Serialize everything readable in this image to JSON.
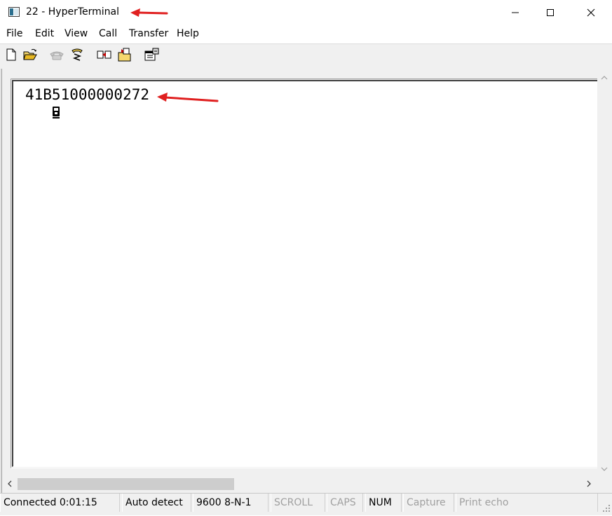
{
  "window": {
    "title": "22 - HyperTerminal",
    "icon": "hyperterminal-app-icon",
    "controls": [
      "minimize-icon",
      "maximize-icon",
      "close-icon"
    ]
  },
  "menu": {
    "items": [
      "File",
      "Edit",
      "View",
      "Call",
      "Transfer",
      "Help"
    ]
  },
  "toolbar": {
    "buttons": [
      {
        "name": "new-connection",
        "icon": "new-document-icon",
        "enabled": true
      },
      {
        "name": "open",
        "icon": "open-folder-icon",
        "enabled": true
      },
      {
        "name": "connect",
        "icon": "phone-icon",
        "enabled": false
      },
      {
        "name": "disconnect",
        "icon": "disconnect-phone-icon",
        "enabled": true
      },
      {
        "name": "send-file",
        "icon": "send-file-icon",
        "enabled": true
      },
      {
        "name": "receive-file",
        "icon": "receive-file-icon",
        "enabled": true
      },
      {
        "name": "properties",
        "icon": "properties-icon",
        "enabled": true
      }
    ]
  },
  "terminal": {
    "line_1": "41B51000000272",
    "leading_glyph": "control-character-glyph"
  },
  "statusbar": {
    "connected": "Connected 0:01:15",
    "detect": "Auto detect",
    "settings": "9600 8-N-1",
    "scroll": "SCROLL",
    "caps": "CAPS",
    "num": "NUM",
    "capture": "Capture",
    "print_echo": "Print echo"
  },
  "colors": {
    "annotation_arrow": "#e02020",
    "chrome": "#f0f0f0",
    "terminal_bg": "#ffffff"
  }
}
